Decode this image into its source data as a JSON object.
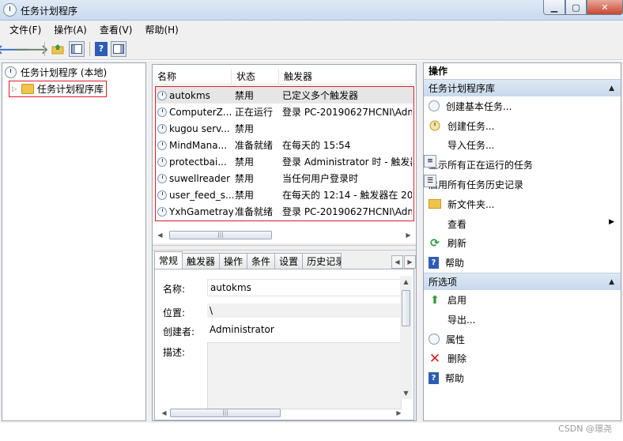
{
  "window": {
    "title": "任务计划程序",
    "min": "▁",
    "max": "▢",
    "close": "✕"
  },
  "menubar": [
    "文件(F)",
    "操作(A)",
    "查看(V)",
    "帮助(H)"
  ],
  "toolbar": {
    "back": "🡐",
    "forward": "🡒",
    "help": "?"
  },
  "tree": {
    "root": "任务计划程序 (本地)",
    "library": "任务计划程序库",
    "expander": "▷"
  },
  "task_list": {
    "columns": [
      "名称",
      "状态",
      "触发器"
    ],
    "rows": [
      {
        "name": "autokms",
        "status": "禁用",
        "trigger": "已定义多个触发器"
      },
      {
        "name": "ComputerZ...",
        "status": "正在运行",
        "trigger": "登录 PC-20190627HCNI\\Adm"
      },
      {
        "name": "kugou serv...",
        "status": "禁用",
        "trigger": ""
      },
      {
        "name": "MindMana...",
        "status": "准备就绪",
        "trigger": "在每天的 15:54"
      },
      {
        "name": "protectbai...",
        "status": "禁用",
        "trigger": "登录 Administrator 时 - 触发器"
      },
      {
        "name": "suwellreader",
        "status": "禁用",
        "trigger": "当任何用户登录时"
      },
      {
        "name": "user_feed_s...",
        "status": "禁用",
        "trigger": "在每天的 12:14 - 触发器在 20"
      },
      {
        "name": "YxhGametray",
        "status": "准备就绪",
        "trigger": "登录 PC-20190627HCNI\\Adm"
      }
    ],
    "scroll_left": "◀",
    "scroll_right": "▶",
    "thumb_grip": "|||"
  },
  "detail": {
    "tabs": [
      "常规",
      "触发器",
      "操作",
      "条件",
      "设置",
      "历史记录"
    ],
    "tab_nav": [
      "◀",
      "▶"
    ],
    "labels": {
      "name": "名称:",
      "location": "位置:",
      "author": "创建者:",
      "description": "描述:"
    },
    "values": {
      "name": "autokms",
      "location": "\\",
      "author": "Administrator",
      "description": ""
    },
    "scroll_up": "▲",
    "scroll_down": "▼"
  },
  "actions_pane": {
    "title": "操作",
    "section1": {
      "header": "任务计划程序库",
      "items": [
        {
          "label": "创建基本任务...",
          "icon": "clock-icon"
        },
        {
          "label": "创建任务...",
          "icon": "task-icon"
        },
        {
          "label": "导入任务...",
          "icon": "blank"
        },
        {
          "label": "显示所有正在运行的任务",
          "icon": "list-icon"
        },
        {
          "label": "启用所有任务历史记录",
          "icon": "history-icon"
        },
        {
          "label": "新文件夹...",
          "icon": "folder-icon"
        },
        {
          "label": "查看",
          "icon": "blank",
          "submenu": "▶"
        },
        {
          "label": "刷新",
          "icon": "refresh-icon"
        },
        {
          "label": "帮助",
          "icon": "help-icon"
        }
      ]
    },
    "section2": {
      "header": "所选项",
      "items": [
        {
          "label": "启用",
          "icon": "run-icon"
        },
        {
          "label": "导出...",
          "icon": "blank"
        },
        {
          "label": "属性",
          "icon": "properties-icon"
        },
        {
          "label": "删除",
          "icon": "delete-icon"
        },
        {
          "label": "帮助",
          "icon": "help-icon"
        }
      ]
    },
    "caret": "▲"
  },
  "watermark": "CSDN @璟尧"
}
